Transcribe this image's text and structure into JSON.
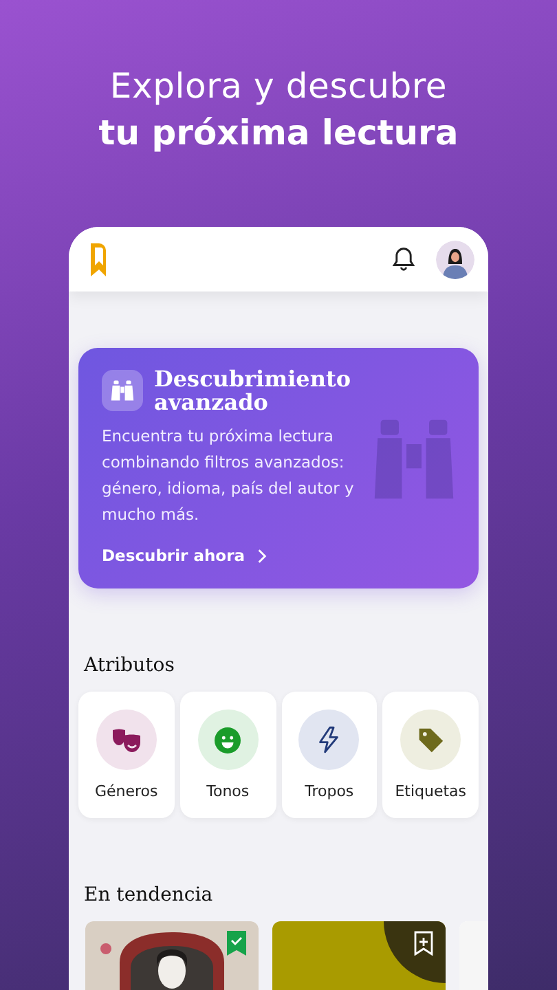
{
  "headline": {
    "line_1": "Explora y descubre",
    "line_2": "tu próxima lectura"
  },
  "promo": {
    "title": "Descubrimiento avanzado",
    "body": "Encuentra tu próxima lectura combinando filtros avanzados: género, idioma, país del autor y mucho más.",
    "link": "Descubrir ahora"
  },
  "attributes": {
    "title": "Atributos",
    "items": [
      {
        "label": "Géneros",
        "kind": "masks",
        "color": "#8b1a5c"
      },
      {
        "label": "Tonos",
        "kind": "smile",
        "color": "#1a9c2a"
      },
      {
        "label": "Tropos",
        "kind": "bolt",
        "color": "#223a7a"
      },
      {
        "label": "Etiquetas",
        "kind": "tag",
        "color": "#6e6a1c"
      }
    ]
  },
  "trending": {
    "title": "En tendencia",
    "books": [
      {
        "kind": "picture",
        "saved": true
      },
      {
        "kind": "picture",
        "saved": false
      },
      {
        "kind": "picture"
      }
    ]
  }
}
